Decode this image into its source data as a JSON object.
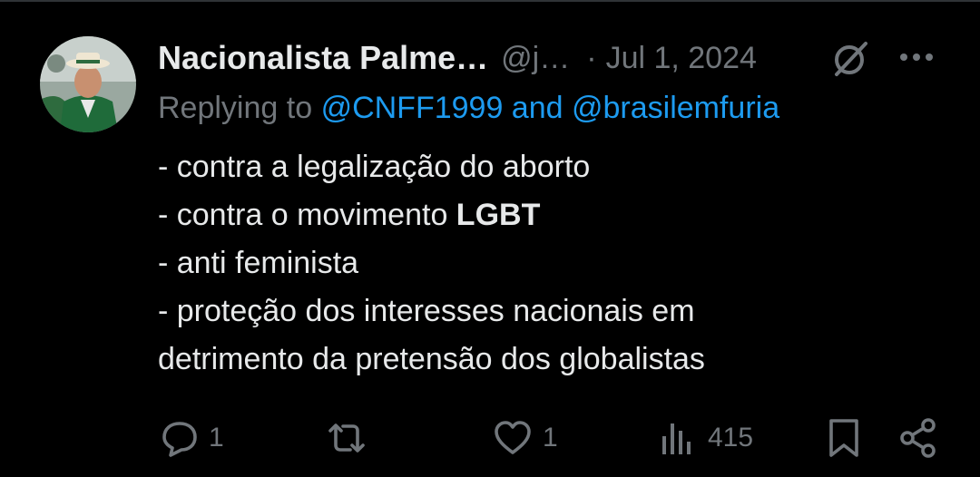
{
  "tweet": {
    "author_name": "Nacionalista Palme…",
    "handle": "@j…",
    "separator": "·",
    "date": "Jul 1, 2024",
    "replying_prefix": "Replying to",
    "replying_to": "@CNFF1999 and @brasilemfuria",
    "lines": [
      "- contra a legalização do aborto",
      "- contra o movimento ",
      "LGBT",
      "- anti feminista",
      "- proteção dos interesses nacionais em",
      "detrimento da pretensão dos globalistas"
    ]
  },
  "actions": {
    "reply_count": "1",
    "like_count": "1",
    "views_count": "415"
  },
  "colors": {
    "background": "#000000",
    "text": "#e7e9ea",
    "muted": "#71767b",
    "link": "#1d9bf0"
  },
  "icons": [
    "grok-icon",
    "more-icon",
    "reply-icon",
    "retweet-icon",
    "like-icon",
    "views-icon",
    "bookmark-icon",
    "share-icon"
  ]
}
